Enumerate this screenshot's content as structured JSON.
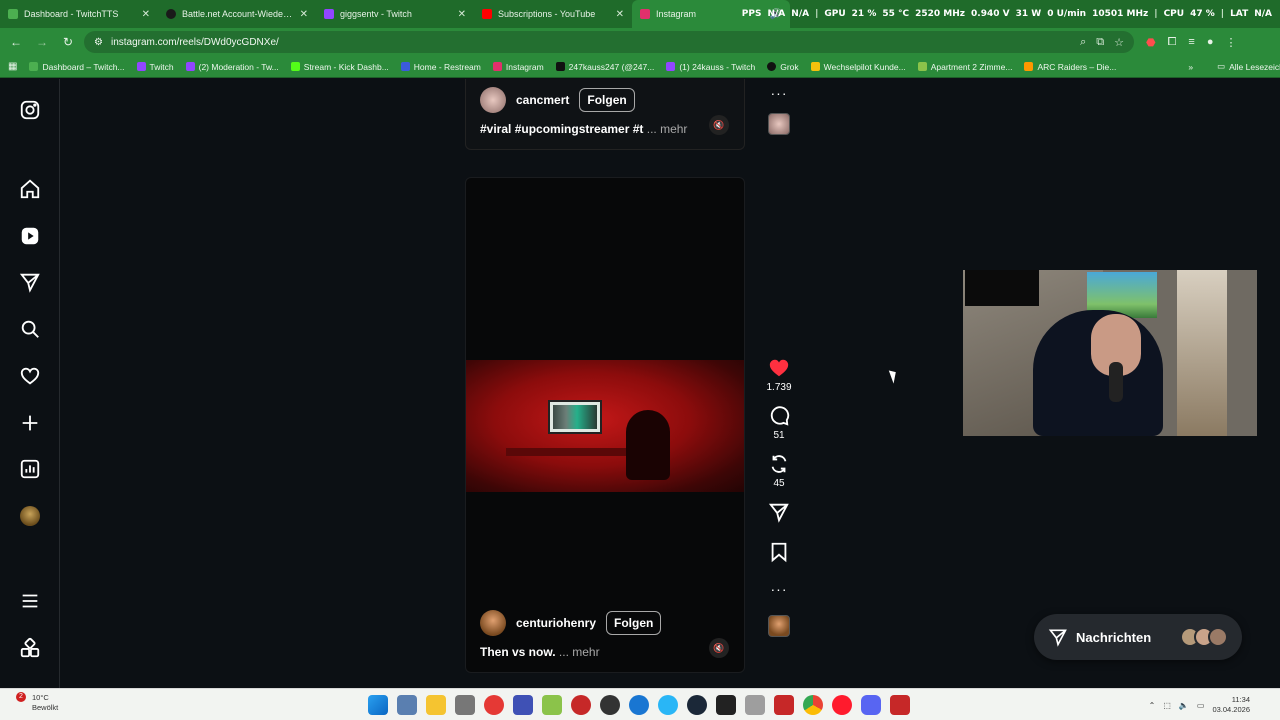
{
  "tabs": [
    {
      "title": "Dashboard - TwitchTTS",
      "color": "#4caf50"
    },
    {
      "title": "Battle.net Account-Wiederhers",
      "color": "#1a1a1a"
    },
    {
      "title": "giggsentv - Twitch",
      "color": "#9146ff"
    },
    {
      "title": "Subscriptions - YouTube",
      "color": "#ff0000"
    },
    {
      "title": "Instagram",
      "color": "#e1306c"
    }
  ],
  "hud": {
    "pps": "PPS",
    "na1": "N/A",
    "na2": "N/A",
    "gpu": "GPU",
    "gpu_load": "21 %",
    "gpu_temp": "55 °C",
    "gpu_clock": "2520 MHz",
    "gpu_volt": "0.940 V",
    "gpu_power": "31 W",
    "fan": "0 U/min",
    "mem": "10501 MHz",
    "cpu": "CPU",
    "cpu_load": "47 %",
    "lat": "LAT",
    "lat_val": "N/A"
  },
  "address": {
    "url": "instagram.com/reels/DWd0ycGDNXe/"
  },
  "bookmarks": [
    {
      "label": "Dashboard – Twitch...",
      "color": "#4caf50"
    },
    {
      "label": "Twitch",
      "color": "#9146ff"
    },
    {
      "label": "(2) Moderation - Tw...",
      "color": "#9146ff"
    },
    {
      "label": "Stream - Kick Dashb...",
      "color": "#53fc18"
    },
    {
      "label": "Home - Restream",
      "color": "#3b5bdb"
    },
    {
      "label": "Instagram",
      "color": "#e1306c"
    },
    {
      "label": "247kauss247 (@247...",
      "color": "#111111"
    },
    {
      "label": "(1) 24kauss - Twitch",
      "color": "#9146ff"
    },
    {
      "label": "Grok",
      "color": "#111111"
    },
    {
      "label": "Wechselpilot Kunde...",
      "color": "#f4c20d"
    },
    {
      "label": "Apartment 2 Zimme...",
      "color": "#8bc34a"
    },
    {
      "label": "ARC Raiders – Die...",
      "color": "#ff9800"
    }
  ],
  "bookmarks_all": "Alle Lesezeichen",
  "reel_prev": {
    "username": "cancmert",
    "follow": "Folgen",
    "caption": "#viral #upcomingstreamer #t",
    "more": "... mehr"
  },
  "reel_current": {
    "username": "centuriohenry",
    "follow": "Folgen",
    "caption": "Then vs now.",
    "more": "... mehr"
  },
  "actions": {
    "likes": "1.739",
    "comments": "51",
    "reposts": "45",
    "like_color": "#ff3040"
  },
  "messages": {
    "label": "Nachrichten"
  },
  "taskbar": {
    "notif": "2",
    "weather_temp": "10°C",
    "weather_text": "Bewölkt",
    "time": "11:34",
    "date": "03.04.2026"
  }
}
